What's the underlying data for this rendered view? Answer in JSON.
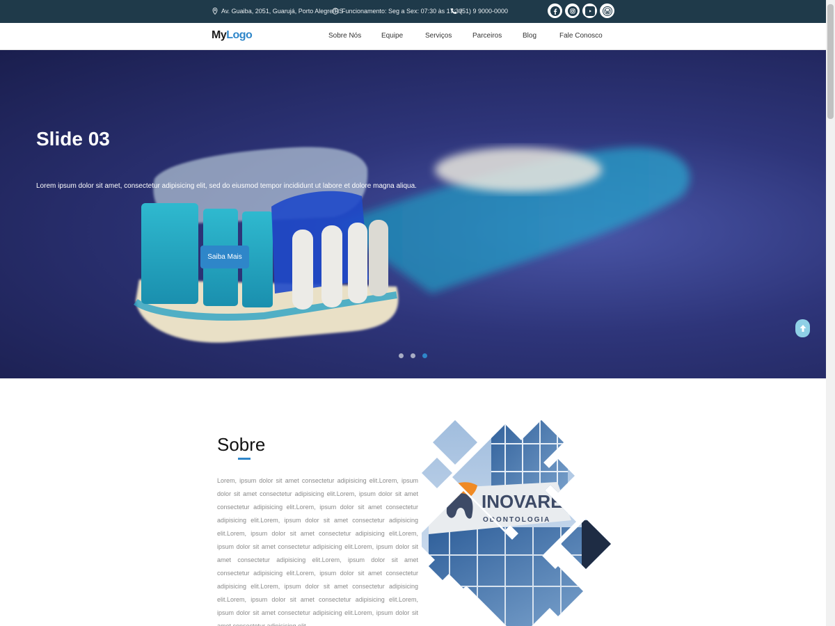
{
  "topbar": {
    "address": "Av. Guaiba, 2051, Guarujá, Porto Alegre/RS",
    "hours": "Funcionamento: Seg a Sex: 07:30 às 17:30",
    "phone": "(51) 9 9000-0000",
    "social": [
      "facebook-icon",
      "instagram-icon",
      "youtube-icon",
      "wordpress-icon"
    ]
  },
  "nav": {
    "logo_my": "My",
    "logo_logo": "Logo",
    "items": [
      "Sobre Nós",
      "Equipe",
      "Serviços",
      "Parceiros",
      "Blog",
      "Fale Conosco"
    ]
  },
  "hero": {
    "title": "Slide 03",
    "text": "Lorem ipsum dolor sit amet, consectetur adipisicing elit, sed do eiusmod tempor incididunt ut labore et dolore magna aliqua.",
    "button": "Saiba Mais",
    "slides": 3,
    "active_slide": 3
  },
  "about": {
    "title": "Sobre",
    "paragraph": "Lorem, ipsum dolor sit amet consectetur adipisicing elit.Lorem, ipsum dolor sit amet consectetur adipisicing elit.Lorem, ipsum dolor sit amet consectetur adipisicing elit.Lorem, ipsum dolor sit amet consectetur adipisicing elit.Lorem, ipsum dolor sit amet consectetur adipisicing elit.Lorem, ipsum dolor sit amet consectetur adipisicing elit.Lorem, ipsum dolor sit amet consectetur adipisicing elit.Lorem, ipsum dolor sit amet consectetur adipisicing elit.Lorem, ipsum dolor sit amet consectetur adipisicing elit.Lorem, ipsum dolor sit amet consectetur adipisicing elit.Lorem, ipsum dolor sit amet consectetur adipisicing elit.Lorem, ipsum dolor sit amet consectetur adipisicing elit.Lorem, ipsum dolor sit amet consectetur adipisicing elit.Lorem, ipsum dolor sit amet consectetur adipisicing elit.",
    "image_brand": "INOVARE",
    "image_sub": "ODONTOLOGIA"
  },
  "colors": {
    "topbar": "#1f3a4a",
    "accent": "#2e86c9",
    "hero_bg": "#2e357a"
  }
}
